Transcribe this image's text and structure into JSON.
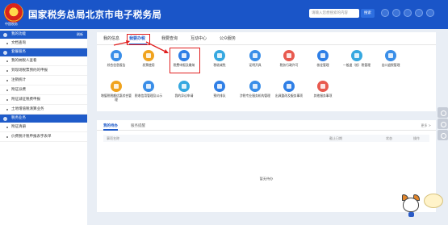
{
  "header": {
    "site_title": "国家税务总局北京市电子税务局",
    "logo_caption": "中国税务",
    "search_placeholder": "请输入您想搜索的内容",
    "search_button": "搜索"
  },
  "sidebar": {
    "section1": {
      "title": "我的功能",
      "right": "刷新"
    },
    "section1_items": [
      "文档查询"
    ],
    "section2": {
      "title": "套餐服务"
    },
    "section2_items": [
      "我的纳税人查看",
      "到现场税票预约的申报",
      "注销统计",
      "附征派费",
      "附征减征税费申报",
      "土地增值税清算业务"
    ],
    "section3": {
      "title": "税务业务"
    },
    "section3_items": [
      "附征清册",
      "价费税计税申报表字表单"
    ]
  },
  "main": {
    "tabs": [
      "我的信息",
      "我要办税",
      "我要查询",
      "互动中心",
      "公众服务"
    ],
    "services_row1": [
      "综合信息报告",
      "发票使用",
      "税费申报及缴纳",
      "税收减免",
      "证明开具",
      "税务行政许可",
      "核定管理",
      "一般退（抵）税管理",
      "出口退税管理"
    ],
    "services_row2": [
      "增值税税额优惠综合管理",
      "税收信用管理及公示",
      "我的异议申请",
      "预约排队",
      "涉税专业服务机构管理",
      "出具整改及服务事项",
      "其他服务事项"
    ]
  },
  "todo": {
    "tabs": [
      "我的待办",
      "服务提醒"
    ],
    "more": "更多 >",
    "columns": [
      "事项名称",
      "截止日期",
      "状态",
      "操作"
    ],
    "empty_text": "暂无待办"
  },
  "colors": {
    "brand": "#1a55c8",
    "accent_red": "#e02020"
  }
}
